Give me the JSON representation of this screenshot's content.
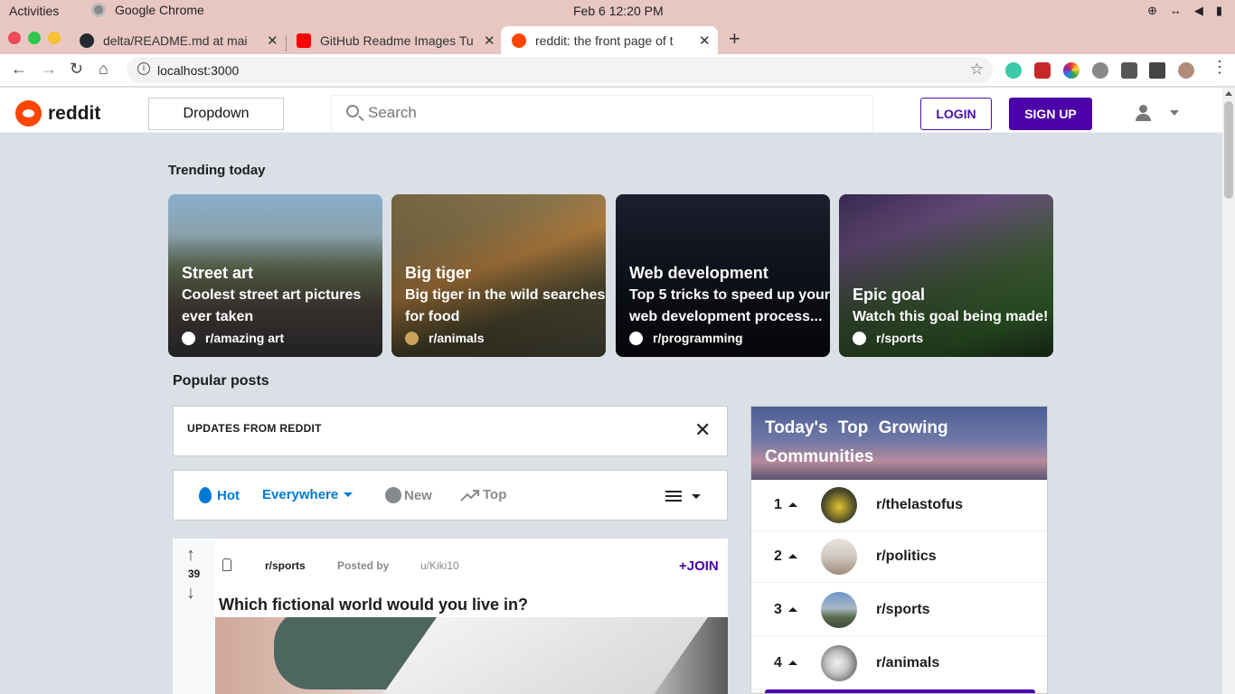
{
  "system": {
    "activities": "Activities",
    "app_name": "Google Chrome",
    "clock": "Feb 6  12:20 PM"
  },
  "browser": {
    "tabs": [
      {
        "title": "delta/README.md at mai",
        "favicon_color": "#24292f",
        "active": false
      },
      {
        "title": "GitHub Readme Images Tu",
        "favicon_color": "#ff0000",
        "active": false
      },
      {
        "title": "reddit: the front page of t",
        "favicon_color": "#ff4500",
        "active": true
      }
    ],
    "url": "localhost:3000"
  },
  "header": {
    "wordmark": "reddit",
    "dropdown_label": "Dropdown",
    "search_placeholder": "Search",
    "login_label": "LOGIN",
    "signup_label": "SIGN UP"
  },
  "trending": {
    "heading": "Trending today",
    "cards": [
      {
        "title": "Street art",
        "desc_lines": [
          "Coolest street art pictures",
          "ever taken"
        ],
        "subreddit": "r/amazing art"
      },
      {
        "title": "Big tiger",
        "desc_lines": [
          "Big tiger in the wild searches",
          "for food"
        ],
        "subreddit": "r/animals"
      },
      {
        "title": "Web development",
        "desc_lines": [
          "Top 5 tricks to speed up your",
          "web development process..."
        ],
        "subreddit": "r/programming"
      },
      {
        "title": "Epic goal",
        "desc_lines": [
          "Watch this goal being made!"
        ],
        "subreddit": "r/sports"
      }
    ]
  },
  "popular": {
    "heading": "Popular posts",
    "updates_label": "UPDATES FROM REDDIT",
    "close_glyph": "✕",
    "sort": {
      "hot": "Hot",
      "scope": "Everywhere",
      "new": "New",
      "top": "Top"
    }
  },
  "post": {
    "votes": "39",
    "up_glyph": "↑",
    "down_glyph": "↓",
    "subreddit": "r/sports",
    "posted_by_label": "Posted by",
    "author": "u/Kiki10",
    "join_label": "+JOIN",
    "title": "Which fictional world would you live in?"
  },
  "communities": {
    "title": "Today's Top Growing Communities",
    "items": [
      {
        "rank": "1",
        "name": "r/thelastofus"
      },
      {
        "rank": "2",
        "name": "r/politics"
      },
      {
        "rank": "3",
        "name": "r/sports"
      },
      {
        "rank": "4",
        "name": "r/animals"
      }
    ]
  },
  "colors": {
    "reddit_orange": "#ff4500",
    "brand_purple": "#4b00a8",
    "link_blue": "#0079d3",
    "page_bg": "#dae0e6"
  }
}
